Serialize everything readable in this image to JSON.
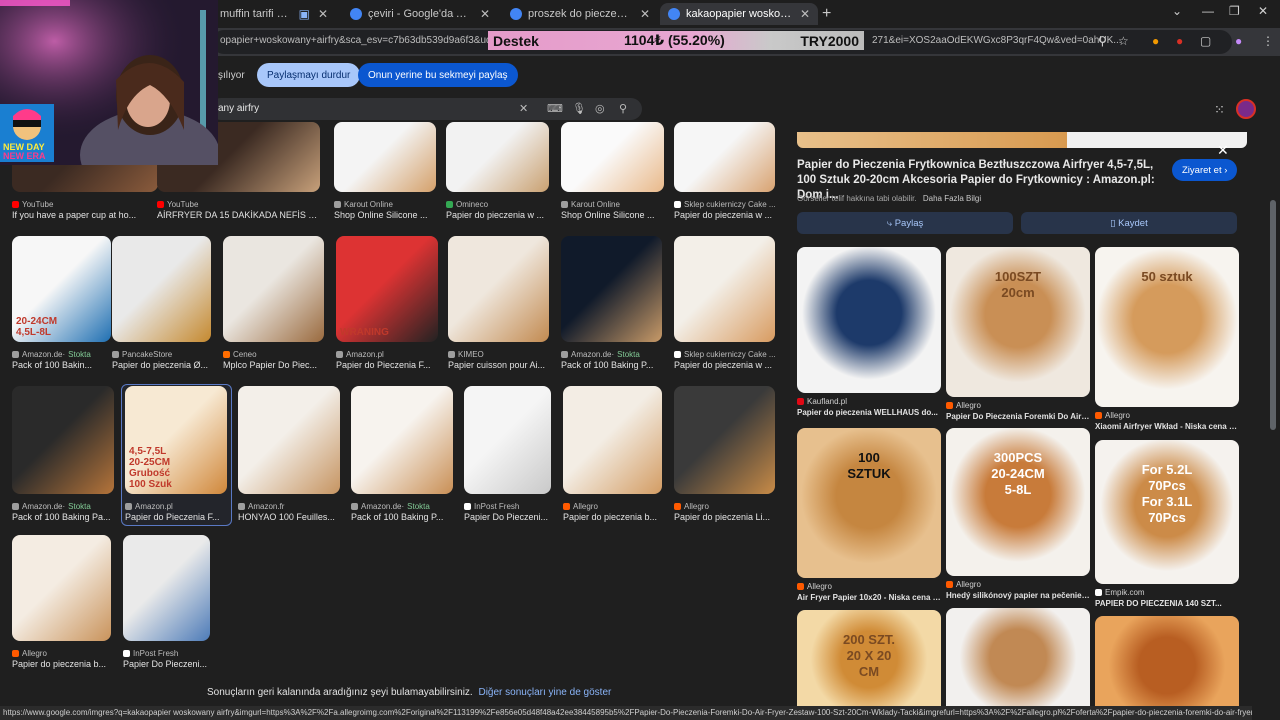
{
  "browser": {
    "tabs": [
      {
        "title": "muffin tarifi - YouTube",
        "favicon_color": "#ff0000"
      },
      {
        "title": "çeviri - Google'da Ara",
        "favicon_color": "#4285f4"
      },
      {
        "title": "proszek do pieczenia - Google",
        "favicon_color": "#4285f4"
      },
      {
        "title": "kakaopapier woskowany airfry",
        "favicon_color": "#4285f4"
      }
    ],
    "new_tab": "+",
    "url_left": "opapier+woskowany+airfry&sca_esv=c7b63db539d9a6f3&udm=",
    "url_right": "271&ei=XOS2aaOdEKWGxc8P3qrF4Qw&ved=0ahUK..."
  },
  "donation": {
    "label": "Destek",
    "value": "1104₺ (55.20%)",
    "goal": "TRY2000",
    "progress": 0.552
  },
  "sharing": {
    "left_text": "şılıyor",
    "stop_label": "Paylaşmayı durdur",
    "share_tab_label": "Onun yerine bu sekmeyi paylaş"
  },
  "search": {
    "query": "any airfry"
  },
  "results": [
    {
      "source": "YouTube",
      "caption": "If you have a paper cup at ho...",
      "src_color": "#ff0000"
    },
    {
      "source": "YouTube",
      "caption": "AİRFRYER DA 15 DAKİKADA NEFİS T...",
      "src_color": "#ff0000"
    },
    {
      "source": "Karout Online",
      "caption": "Shop Online Silicone ...",
      "src_color": "#9e9e9e"
    },
    {
      "source": "Omineco",
      "caption": "Papier do pieczenia w ...",
      "src_color": "#34a853"
    },
    {
      "source": "Karout Online",
      "caption": "Shop Online Silicone ...",
      "src_color": "#9e9e9e"
    },
    {
      "source": "Sklep cukierniczy Cake ...",
      "caption": "Papier do pieczenia w ...",
      "src_color": "#ffffff"
    },
    {
      "source": "Amazon.de",
      "stock": "Stokta",
      "caption": "Pack of 100 Bakin...",
      "src_color": "#9e9e9e",
      "img_text": "20-24CM\n4,5L-8L"
    },
    {
      "source": "PancakeStore",
      "caption": "Papier do pieczenia Ø...",
      "src_color": "#9e9e9e"
    },
    {
      "source": "Ceneo",
      "caption": "Mplco Papier Do Piec...",
      "src_color": "#ff6d00"
    },
    {
      "source": "Amazon.pl",
      "caption": "Papier do Pieczenia F...",
      "src_color": "#9e9e9e",
      "img_text": "WRANING"
    },
    {
      "source": "KIMEO",
      "caption": "Papier cuisson pour Ai...",
      "src_color": "#9e9e9e"
    },
    {
      "source": "Amazon.de",
      "stock": "Stokta",
      "caption": "Pack of 100 Baking P...",
      "src_color": "#9e9e9e"
    },
    {
      "source": "Sklep cukierniczy Cake ...",
      "caption": "Papier do pieczenia w ...",
      "src_color": "#ffffff"
    },
    {
      "source": "Amazon.de",
      "stock": "Stokta",
      "caption": "Pack of 100 Baking Pa...",
      "src_color": "#9e9e9e"
    },
    {
      "source": "Amazon.pl",
      "caption": "Papier do Pieczenia F...",
      "src_color": "#9e9e9e",
      "img_text": "4,5-7,5L\n20-25CM\nGrubość\n100 Szuk"
    },
    {
      "source": "Amazon.fr",
      "caption": "HONYAO 100 Feuilles...",
      "src_color": "#9e9e9e"
    },
    {
      "source": "Amazon.de",
      "stock": "Stokta",
      "caption": "Pack of 100 Baking P...",
      "src_color": "#9e9e9e"
    },
    {
      "source": "InPost Fresh",
      "caption": "Papier Do Pieczeni...",
      "src_color": "#ffffff"
    },
    {
      "source": "Allegro",
      "caption": "Papier do pieczenia b...",
      "src_color": "#ff5a00"
    },
    {
      "source": "Allegro",
      "caption": "Papier do pieczenia Li...",
      "src_color": "#ff5a00"
    },
    {
      "source": "Allegro",
      "caption": "Papier do pieczenia b...",
      "src_color": "#ff5a00"
    },
    {
      "source": "InPost Fresh",
      "caption": "Papier Do Pieczeni...",
      "src_color": "#ffffff"
    }
  ],
  "end_message": {
    "text": "Sonuçların geri kalanında aradığınız şeyi bulamayabilirsiniz.",
    "link": "Diğer sonuçları yine de göster"
  },
  "panel": {
    "title": "Papier do Pieczenia Frytkownica Beztłuszczowa Airfryer 4,5-7,5L, 100 Sztuk 20-20cm Akcesoria Papier do Frytkownicy : Amazon.pl: Dom i...",
    "visit_label": "Ziyaret et",
    "copyright": "Görseller telif hakkına tabi olabilir.",
    "learn_more": "Daha Fazla Bilgi",
    "share_label": "Paylaş",
    "save_label": "Kaydet",
    "related": [
      {
        "source": "Kaufland.pl",
        "caption": "Papier do pieczenia WELLHAUS do...",
        "src_color": "#e10915",
        "img_text": ""
      },
      {
        "source": "Allegro",
        "caption": "Papier Do Pieczenia Foremki Do Air Fry...",
        "src_color": "#ff5a00",
        "img_text": "100SZT\n20cm"
      },
      {
        "source": "Allegro",
        "caption": "Xiaomi Airfryer Wkład - Niska cena na...",
        "src_color": "#ff5a00",
        "img_text": "50 sztuk"
      },
      {
        "source": "Allegro",
        "caption": "Air Fryer Papier 10x20 - Niska cena na...",
        "src_color": "#ff5a00",
        "img_text": "100\nSZTUK"
      },
      {
        "source": "Allegro",
        "caption": "Hnedý silikónový papier na pečenie 20...",
        "src_color": "#ff5a00",
        "img_text": "300PCS\n20-24CM\n5-8L"
      },
      {
        "source": "Empik.com",
        "caption": "PAPIER DO PIECZENIA 140 SZT...",
        "src_color": "#ffffff",
        "img_text": "For 5.2L\n70Pcs\nFor 3.1L\n70Pcs"
      },
      {
        "source": "",
        "caption": "",
        "src_color": "#ff5a00",
        "img_text": "200 SZT.\n20 X 20\nCM"
      },
      {
        "source": "",
        "caption": "",
        "src_color": "#ff5a00",
        "img_text": ""
      },
      {
        "source": "",
        "caption": "",
        "src_color": "#ff5a00",
        "img_text": ""
      }
    ]
  },
  "status_url": "https://www.google.com/imgres?q=kakaopapier woskowany airfry&imgurl=https%3A%2F%2Fa.allegroimg.com%2Foriginal%2F113199%2Fe856e05d48f48a42ee38445895b5%2FPapier-Do-Pieczenia-Foremki-Do-Air-Fryer-Zestaw-100-Szt-20Cm-Wklady-Tacki&imgrefurl=https%3A%2F%2Fallegro.pl%2Foferta%2Fpapier-do-pieczenia-foremki-do-air-fryer-...",
  "webcam": {
    "sticker_text": "NEW DAY\nNEW ERA"
  },
  "colors": {
    "accent_blue": "#0b57d0",
    "light_blue": "#a8c7fa",
    "bg": "#1f1f1f",
    "link": "#8ab4f8"
  }
}
